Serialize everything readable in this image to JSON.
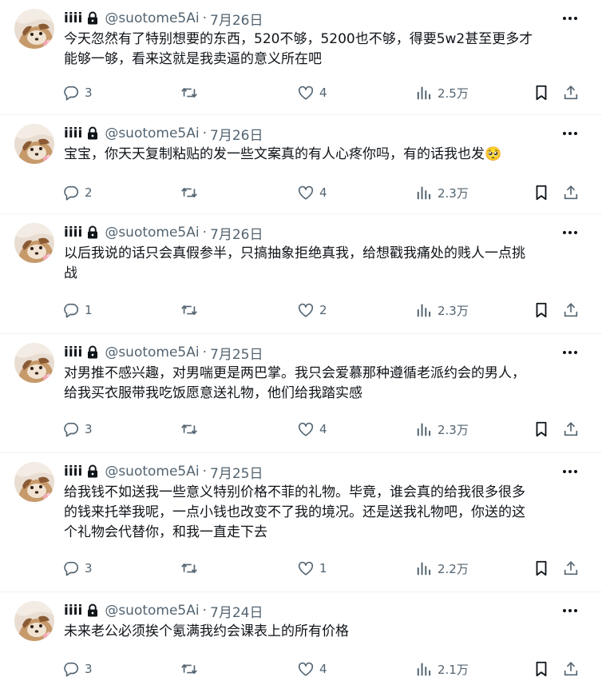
{
  "tweets": [
    {
      "name": "iiii",
      "handle": "@suotome5Ai",
      "separator": "·",
      "date": "7月26日",
      "text": "今天忽然有了特别想要的东西，520不够，5200也不够，得要5w2甚至更多才\n能够一够，看来这就是我卖逼的意义所在吧",
      "replies": "3",
      "retweets": "",
      "likes": "4",
      "views": "2.5万"
    },
    {
      "name": "iiii",
      "handle": "@suotome5Ai",
      "separator": "·",
      "date": "7月26日",
      "text": "宝宝，你天天复制粘贴的发一些文案真的有人心疼你吗，有的话我也发🥺",
      "replies": "2",
      "retweets": "",
      "likes": "4",
      "views": "2.3万"
    },
    {
      "name": "iiii",
      "handle": "@suotome5Ai",
      "separator": "·",
      "date": "7月26日",
      "text": "以后我说的话只会真假参半，只搞抽象拒绝真我，给想戳我痛处的贱人一点挑\n战",
      "replies": "1",
      "retweets": "",
      "likes": "2",
      "views": "2.3万"
    },
    {
      "name": "iiii",
      "handle": "@suotome5Ai",
      "separator": "·",
      "date": "7月25日",
      "text": "对男推不感兴趣，对男喘更是两巴掌。我只会爱慕那种遵循老派约会的男人，\n给我买衣服带我吃饭愿意送礼物，他们给我踏实感",
      "replies": "3",
      "retweets": "",
      "likes": "4",
      "views": "2.3万"
    },
    {
      "name": "iiii",
      "handle": "@suotome5Ai",
      "separator": "·",
      "date": "7月25日",
      "text": "给我钱不如送我一些意义特别价格不菲的礼物。毕竟，谁会真的给我很多很多\n的钱来托举我呢，一点小钱也改变不了我的境况。还是送我礼物吧，你送的这\n个礼物会代替你，和我一直走下去",
      "replies": "3",
      "retweets": "",
      "likes": "1",
      "views": "2.2万"
    },
    {
      "name": "iiii",
      "handle": "@suotome5Ai",
      "separator": "·",
      "date": "7月24日",
      "text": "未来老公必须挨个氪满我约会课表上的所有价格",
      "replies": "3",
      "retweets": "",
      "likes": "4",
      "views": "2.1万"
    }
  ],
  "icons": {
    "avatar": "avatar-photo",
    "lock": "lock-icon",
    "more": "more-options-icon",
    "reply": "reply-icon",
    "retweet": "retweet-icon",
    "like": "like-icon",
    "views": "views-icon",
    "bookmark": "bookmark-icon",
    "share": "share-icon"
  },
  "colors": {
    "text_primary": "#0f1419",
    "text_secondary": "#536471",
    "divider": "#eff3f4",
    "background": "#ffffff"
  }
}
